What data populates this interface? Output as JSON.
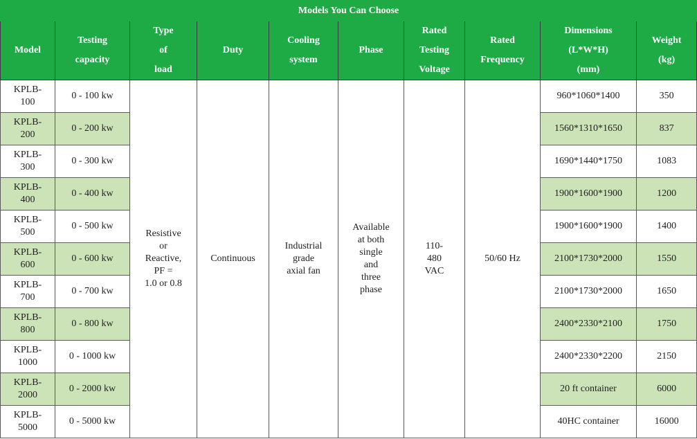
{
  "title": "Models You Can Choose",
  "headers": {
    "model": "Model",
    "capacity": "Testing\ncapacity",
    "load": "Type\nof\nload",
    "duty": "Duty",
    "cooling": "Cooling\nsystem",
    "phase": "Phase",
    "voltage": "Rated\nTesting\nVoltage",
    "frequency": "Rated\nFrequency",
    "dimensions": "Dimensions\n(L*W*H)\n(mm)",
    "weight": "Weight\n(kg)"
  },
  "shared": {
    "load": "Resistive\nor\nReactive,\nPF =\n1.0 or 0.8",
    "duty": "Continuous",
    "cooling": "Industrial\ngrade\naxial fan",
    "phase": "Available\nat both\nsingle\nand\nthree\nphase",
    "voltage": "110-\n480\nVAC",
    "frequency": "50/60 Hz"
  },
  "rows": [
    {
      "model": "KPLB-\n100",
      "capacity": "0 - 100 kw",
      "dimensions": "960*1060*1400",
      "weight": "350"
    },
    {
      "model": "KPLB-\n200",
      "capacity": "0 - 200 kw",
      "dimensions": "1560*1310*1650",
      "weight": "837"
    },
    {
      "model": "KPLB-\n300",
      "capacity": "0 - 300 kw",
      "dimensions": "1690*1440*1750",
      "weight": "1083"
    },
    {
      "model": "KPLB-\n400",
      "capacity": "0 - 400 kw",
      "dimensions": "1900*1600*1900",
      "weight": "1200"
    },
    {
      "model": "KPLB-\n500",
      "capacity": "0 - 500 kw",
      "dimensions": "1900*1600*1900",
      "weight": "1400"
    },
    {
      "model": "KPLB-\n600",
      "capacity": "0 - 600 kw",
      "dimensions": "2100*1730*2000",
      "weight": "1550"
    },
    {
      "model": "KPLB-\n700",
      "capacity": "0 - 700 kw",
      "dimensions": "2100*1730*2000",
      "weight": "1650"
    },
    {
      "model": "KPLB-\n800",
      "capacity": "0 - 800 kw",
      "dimensions": "2400*2330*2100",
      "weight": "1750"
    },
    {
      "model": "KPLB-\n1000",
      "capacity": "0 - 1000 kw",
      "dimensions": "2400*2330*2200",
      "weight": "2150"
    },
    {
      "model": "KPLB-\n2000",
      "capacity": "0 - 2000 kw",
      "dimensions": "20 ft container",
      "weight": "6000"
    },
    {
      "model": "KPLB-\n5000",
      "capacity": "0 - 5000 kw",
      "dimensions": "40HC container",
      "weight": "16000"
    }
  ],
  "colors": {
    "header_green": "#1eaa45",
    "row_shade": "#cce3b8",
    "border": "#5a5a5a"
  }
}
